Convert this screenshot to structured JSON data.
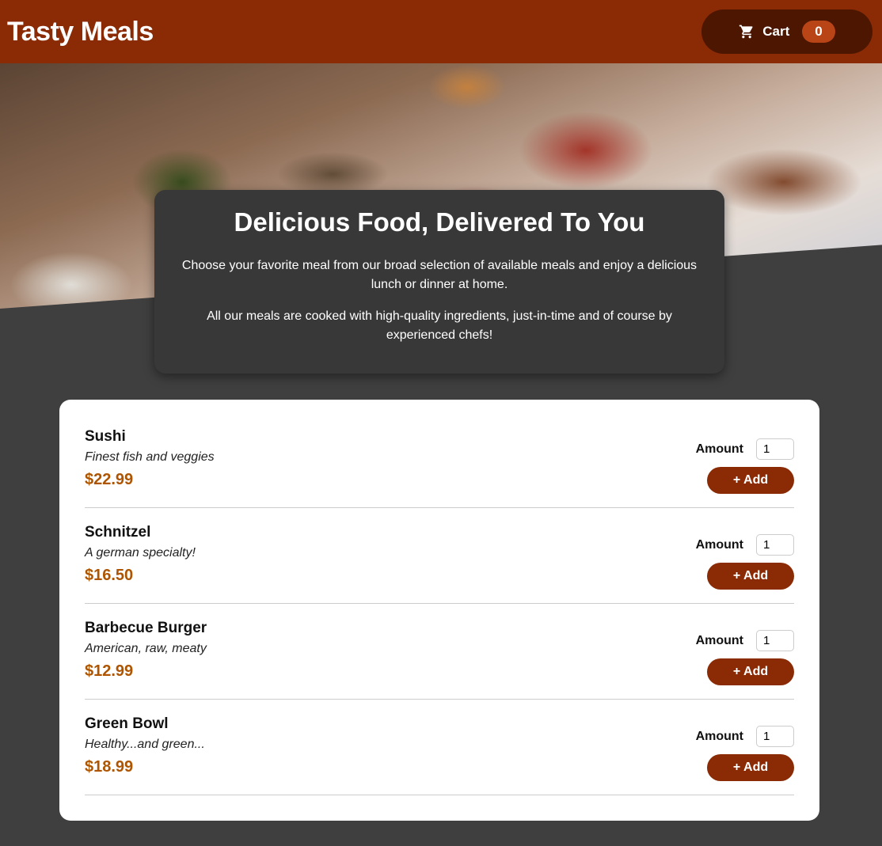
{
  "header": {
    "title": "Tasty Meals",
    "cart": {
      "label": "Cart",
      "count": "0"
    }
  },
  "summary": {
    "heading": "Delicious Food, Delivered To You",
    "paragraphs": [
      "Choose your favorite meal from our broad selection of available meals and enjoy a delicious lunch or dinner at home.",
      "All our meals are cooked with high-quality ingredients, just-in-time and of course by experienced chefs!"
    ]
  },
  "meals": [
    {
      "name": "Sushi",
      "description": "Finest fish and veggies",
      "price": "$22.99",
      "amount_label": "Amount",
      "amount": "1",
      "add_label": "+ Add"
    },
    {
      "name": "Schnitzel",
      "description": "A german specialty!",
      "price": "$16.50",
      "amount_label": "Amount",
      "amount": "1",
      "add_label": "+ Add"
    },
    {
      "name": "Barbecue Burger",
      "description": "American, raw, meaty",
      "price": "$12.99",
      "amount_label": "Amount",
      "amount": "1",
      "add_label": "+ Add"
    },
    {
      "name": "Green Bowl",
      "description": "Healthy...and green...",
      "price": "$18.99",
      "amount_label": "Amount",
      "amount": "1",
      "add_label": "+ Add"
    }
  ],
  "colors": {
    "header_bg": "#8a2b06",
    "cart_bg": "#4d1601",
    "badge_bg": "#b94517",
    "price": "#ad5502",
    "page_bg": "#3f3f3f"
  },
  "icons": {
    "cart": "shopping-cart-icon",
    "hero": "food-buffet-image"
  }
}
